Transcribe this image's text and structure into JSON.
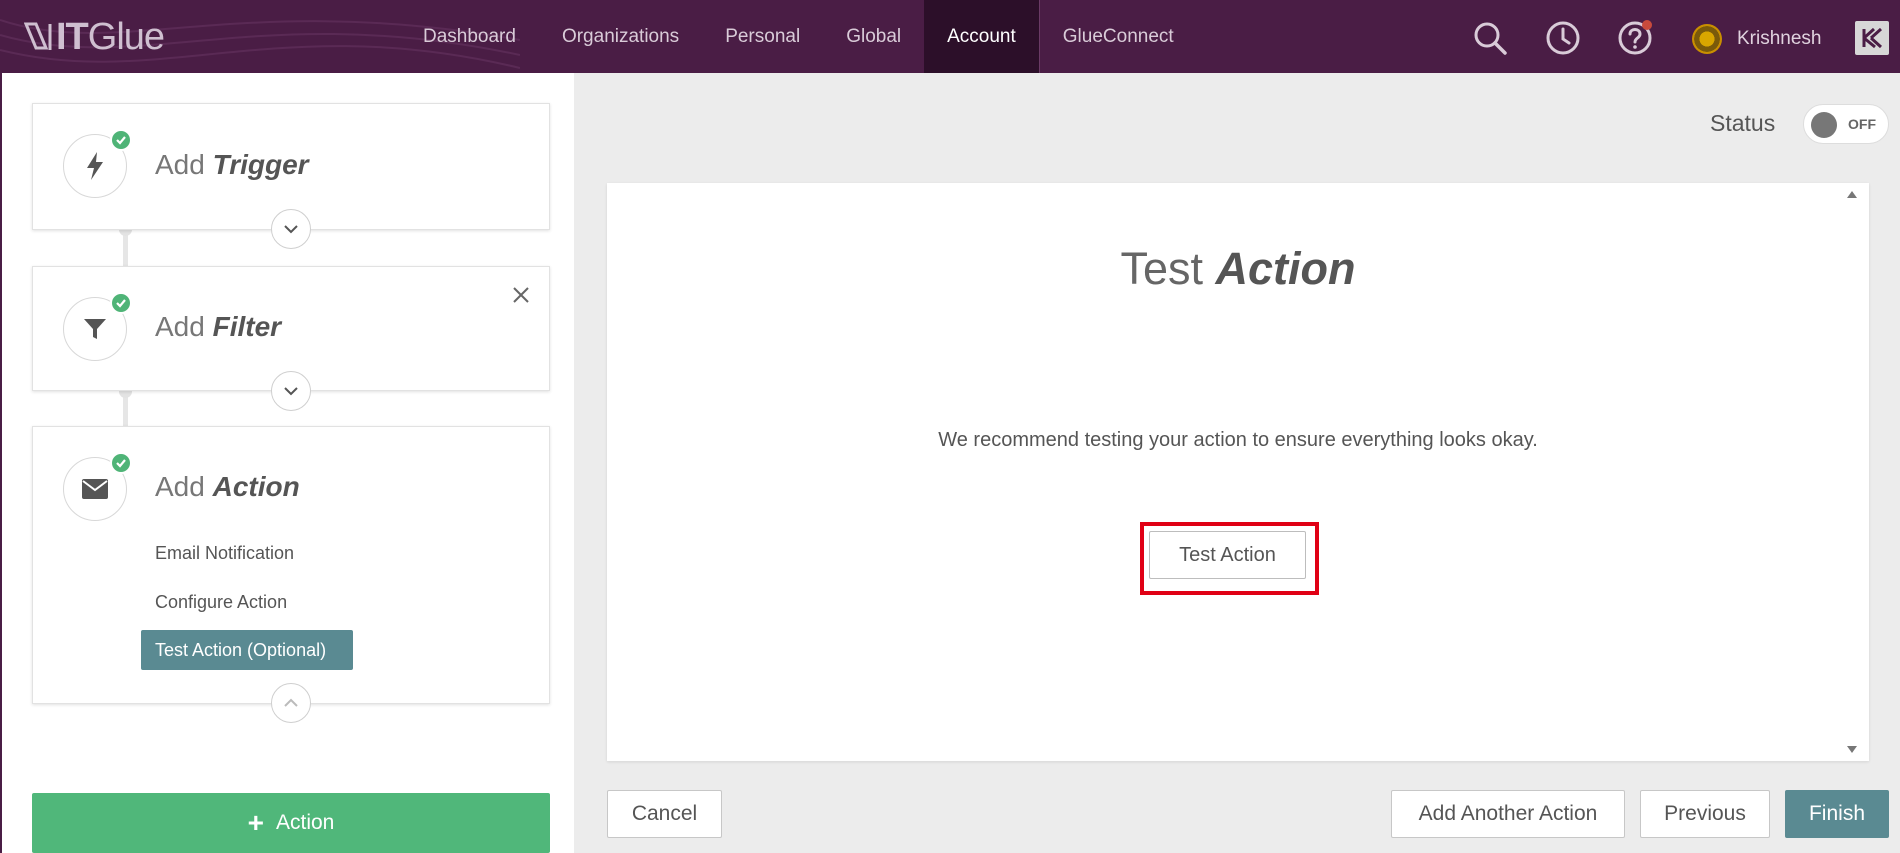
{
  "topbar": {
    "logo": {
      "part1": "IT",
      "part2": "Glue"
    },
    "nav": [
      {
        "label": "Dashboard",
        "active": false
      },
      {
        "label": "Organizations",
        "active": false
      },
      {
        "label": "Personal",
        "active": false
      },
      {
        "label": "Global",
        "active": false
      },
      {
        "label": "Account",
        "active": true
      },
      {
        "label": "GlueConnect",
        "active": false
      }
    ],
    "icons": [
      "search-icon",
      "history-clock-icon",
      "help-icon"
    ],
    "user_name": "Krishnesh",
    "brand_color": "#4a1d45"
  },
  "workflow": {
    "steps": [
      {
        "prefix": "Add",
        "name": "Trigger",
        "icon": "bolt-icon",
        "complete": true
      },
      {
        "prefix": "Add",
        "name": "Filter",
        "icon": "filter-icon",
        "complete": true
      },
      {
        "prefix": "Add",
        "name": "Action",
        "icon": "envelope-icon",
        "complete": true
      }
    ],
    "action_substeps": [
      {
        "label": "Email Notification",
        "active": false
      },
      {
        "label": "Configure Action",
        "active": false
      },
      {
        "label": "Test Action (Optional)",
        "active": true
      }
    ],
    "add_action_button": {
      "plus": "+",
      "label": "Action"
    }
  },
  "status": {
    "label": "Status",
    "toggle_text": "OFF"
  },
  "main": {
    "title_prefix": "Test",
    "title_emphasis": "Action",
    "description": "We recommend testing your action to ensure everything looks okay.",
    "test_button": "Test Action"
  },
  "footer": {
    "cancel": "Cancel",
    "add_another": "Add Another Action",
    "previous": "Previous",
    "finish": "Finish"
  },
  "colors": {
    "accent": "#5a8a92",
    "success": "#50b77a",
    "highlight": "#e00015"
  }
}
